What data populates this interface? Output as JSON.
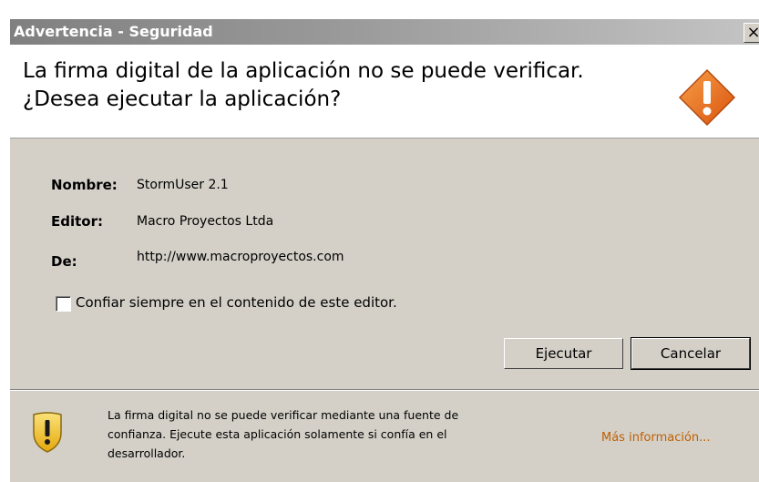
{
  "window": {
    "title": "Advertencia - Seguridad",
    "close_glyph": "×"
  },
  "header": {
    "line1": "La firma digital de la aplicación no se puede verificar.",
    "line2": "¿Desea ejecutar la aplicación?",
    "icon": "warning-diamond-icon"
  },
  "fields": [
    {
      "label": "Nombre:",
      "value": "StormUser 2.1"
    },
    {
      "label": "Editor:",
      "value": "Macro Proyectos Ltda"
    },
    {
      "label": "De:",
      "value": "http://www.macroproyectos.com"
    }
  ],
  "trust_checkbox": {
    "label": "Confiar siempre en el contenido de este editor.",
    "checked": false
  },
  "buttons": {
    "run": "Ejecutar",
    "cancel": "Cancelar"
  },
  "footer": {
    "icon": "shield-warning-icon",
    "line1": "La firma digital no se puede verificar mediante una fuente de",
    "line2": "confianza.  Ejecute esta aplicación solamente si confía en el",
    "line3": "desarrollador.",
    "more_info": "Más información..."
  },
  "colors": {
    "titlebar_text": "#ffffff",
    "dialog_bg": "#d4d0c8",
    "link": "#c06000",
    "warning_orange": "#e8701a",
    "shield_yellow": "#f2c81e"
  }
}
